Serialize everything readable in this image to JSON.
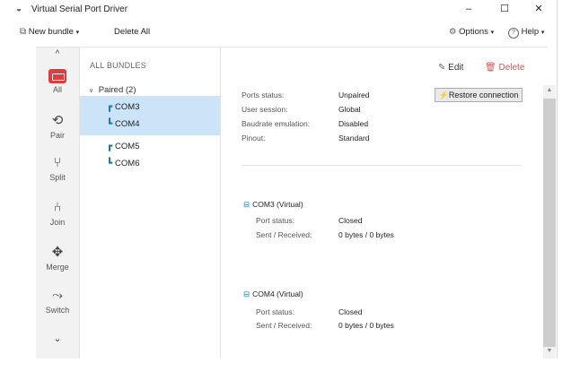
{
  "window": {
    "title": "Virtual Serial Port Driver",
    "controls": {
      "minimize": "–",
      "maximize": "☐",
      "close": "✕"
    }
  },
  "toolbar": {
    "new_bundle": "New bundle",
    "delete_all": "Delete All",
    "options": "Options",
    "help": "Help"
  },
  "sidebar": {
    "up_arrow": "^",
    "items": [
      {
        "label": "All",
        "icon": "serial-port-icon",
        "active": true
      },
      {
        "label": "Pair",
        "icon": "pair-icon"
      },
      {
        "label": "Split",
        "icon": "split-icon"
      },
      {
        "label": "Join",
        "icon": "join-icon"
      },
      {
        "label": "Merge",
        "icon": "merge-icon"
      },
      {
        "label": "Switch",
        "icon": "switch-icon"
      }
    ]
  },
  "tree": {
    "heading": "ALL BUNDLES",
    "group_label": "Paired (2)",
    "bundles": [
      {
        "a": "COM3",
        "b": "COM4",
        "selected": true
      },
      {
        "a": "COM5",
        "b": "COM6",
        "selected": false
      }
    ]
  },
  "details": {
    "edit": "Edit",
    "delete": "Delete",
    "restore": "Restore connection",
    "summary": [
      {
        "label": "Ports status:",
        "value": "Unpaired"
      },
      {
        "label": "User session:",
        "value": "Global"
      },
      {
        "label": "Baudrate emulation:",
        "value": "Disabled"
      },
      {
        "label": "Pinout:",
        "value": "Standard"
      }
    ],
    "devices": [
      {
        "title": "COM3 (Virtual)",
        "rows": [
          {
            "label": "Port status:",
            "value": "Closed"
          },
          {
            "label": "Sent / Received:",
            "value": "0 bytes / 0 bytes"
          }
        ]
      },
      {
        "title": "COM4 (Virtual)",
        "rows": [
          {
            "label": "Port status:",
            "value": "Closed"
          },
          {
            "label": "Sent / Received:",
            "value": "0 bytes / 0 bytes"
          }
        ]
      }
    ]
  },
  "colors": {
    "accent": "#1e73be",
    "delete": "#d9534f",
    "selection": "#cce4f7",
    "active_icon": "#e03c3c"
  }
}
